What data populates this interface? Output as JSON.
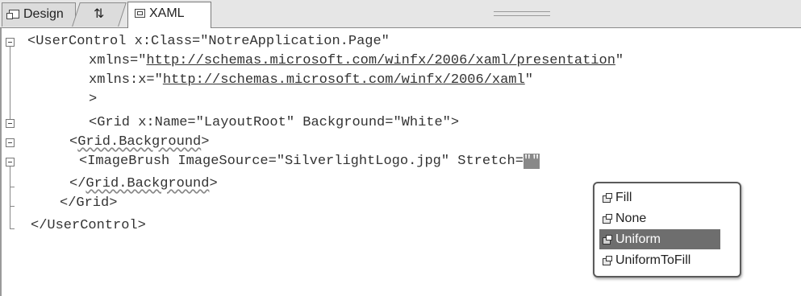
{
  "tabs": [
    {
      "label": "Design",
      "icon": "design-view-icon"
    },
    {
      "label": "⇅",
      "icon": "swap-panes-icon"
    },
    {
      "label": "XAML",
      "icon": "xaml-view-icon",
      "active": true
    }
  ],
  "code": {
    "line1": "<UserControl x:Class=\"NotreApplication.Page\"",
    "line2_pre": "xmlns=\"",
    "line2_link": "http://schemas.microsoft.com/winfx/2006/xaml/presentation",
    "line2_post": "\"",
    "line3_pre": "xmlns:x=\"",
    "line3_link": "http://schemas.microsoft.com/winfx/2006/xaml",
    "line3_post": "\"",
    "line4": ">",
    "line5": "<Grid x:Name=\"LayoutRoot\" Background=\"White\">",
    "line6_lt": "<",
    "line6_tag": "Grid.Background",
    "line6_gt": ">",
    "line7_pre": "<ImageBrush ImageSource=\"SilverlightLogo.jpg\" Stretch=",
    "line7_caret": "\"\"",
    "line8_lt": "</",
    "line8_tag": "Grid.Background",
    "line8_gt": ">",
    "line9": "</Grid>",
    "line10": "</UserControl>"
  },
  "intellisense": {
    "options": [
      {
        "label": "Fill",
        "icon": "enum-value-icon"
      },
      {
        "label": "None",
        "icon": "enum-value-icon"
      },
      {
        "label": "Uniform",
        "icon": "enum-value-icon",
        "selected": true
      },
      {
        "label": "UniformToFill",
        "icon": "enum-value-icon"
      }
    ]
  }
}
